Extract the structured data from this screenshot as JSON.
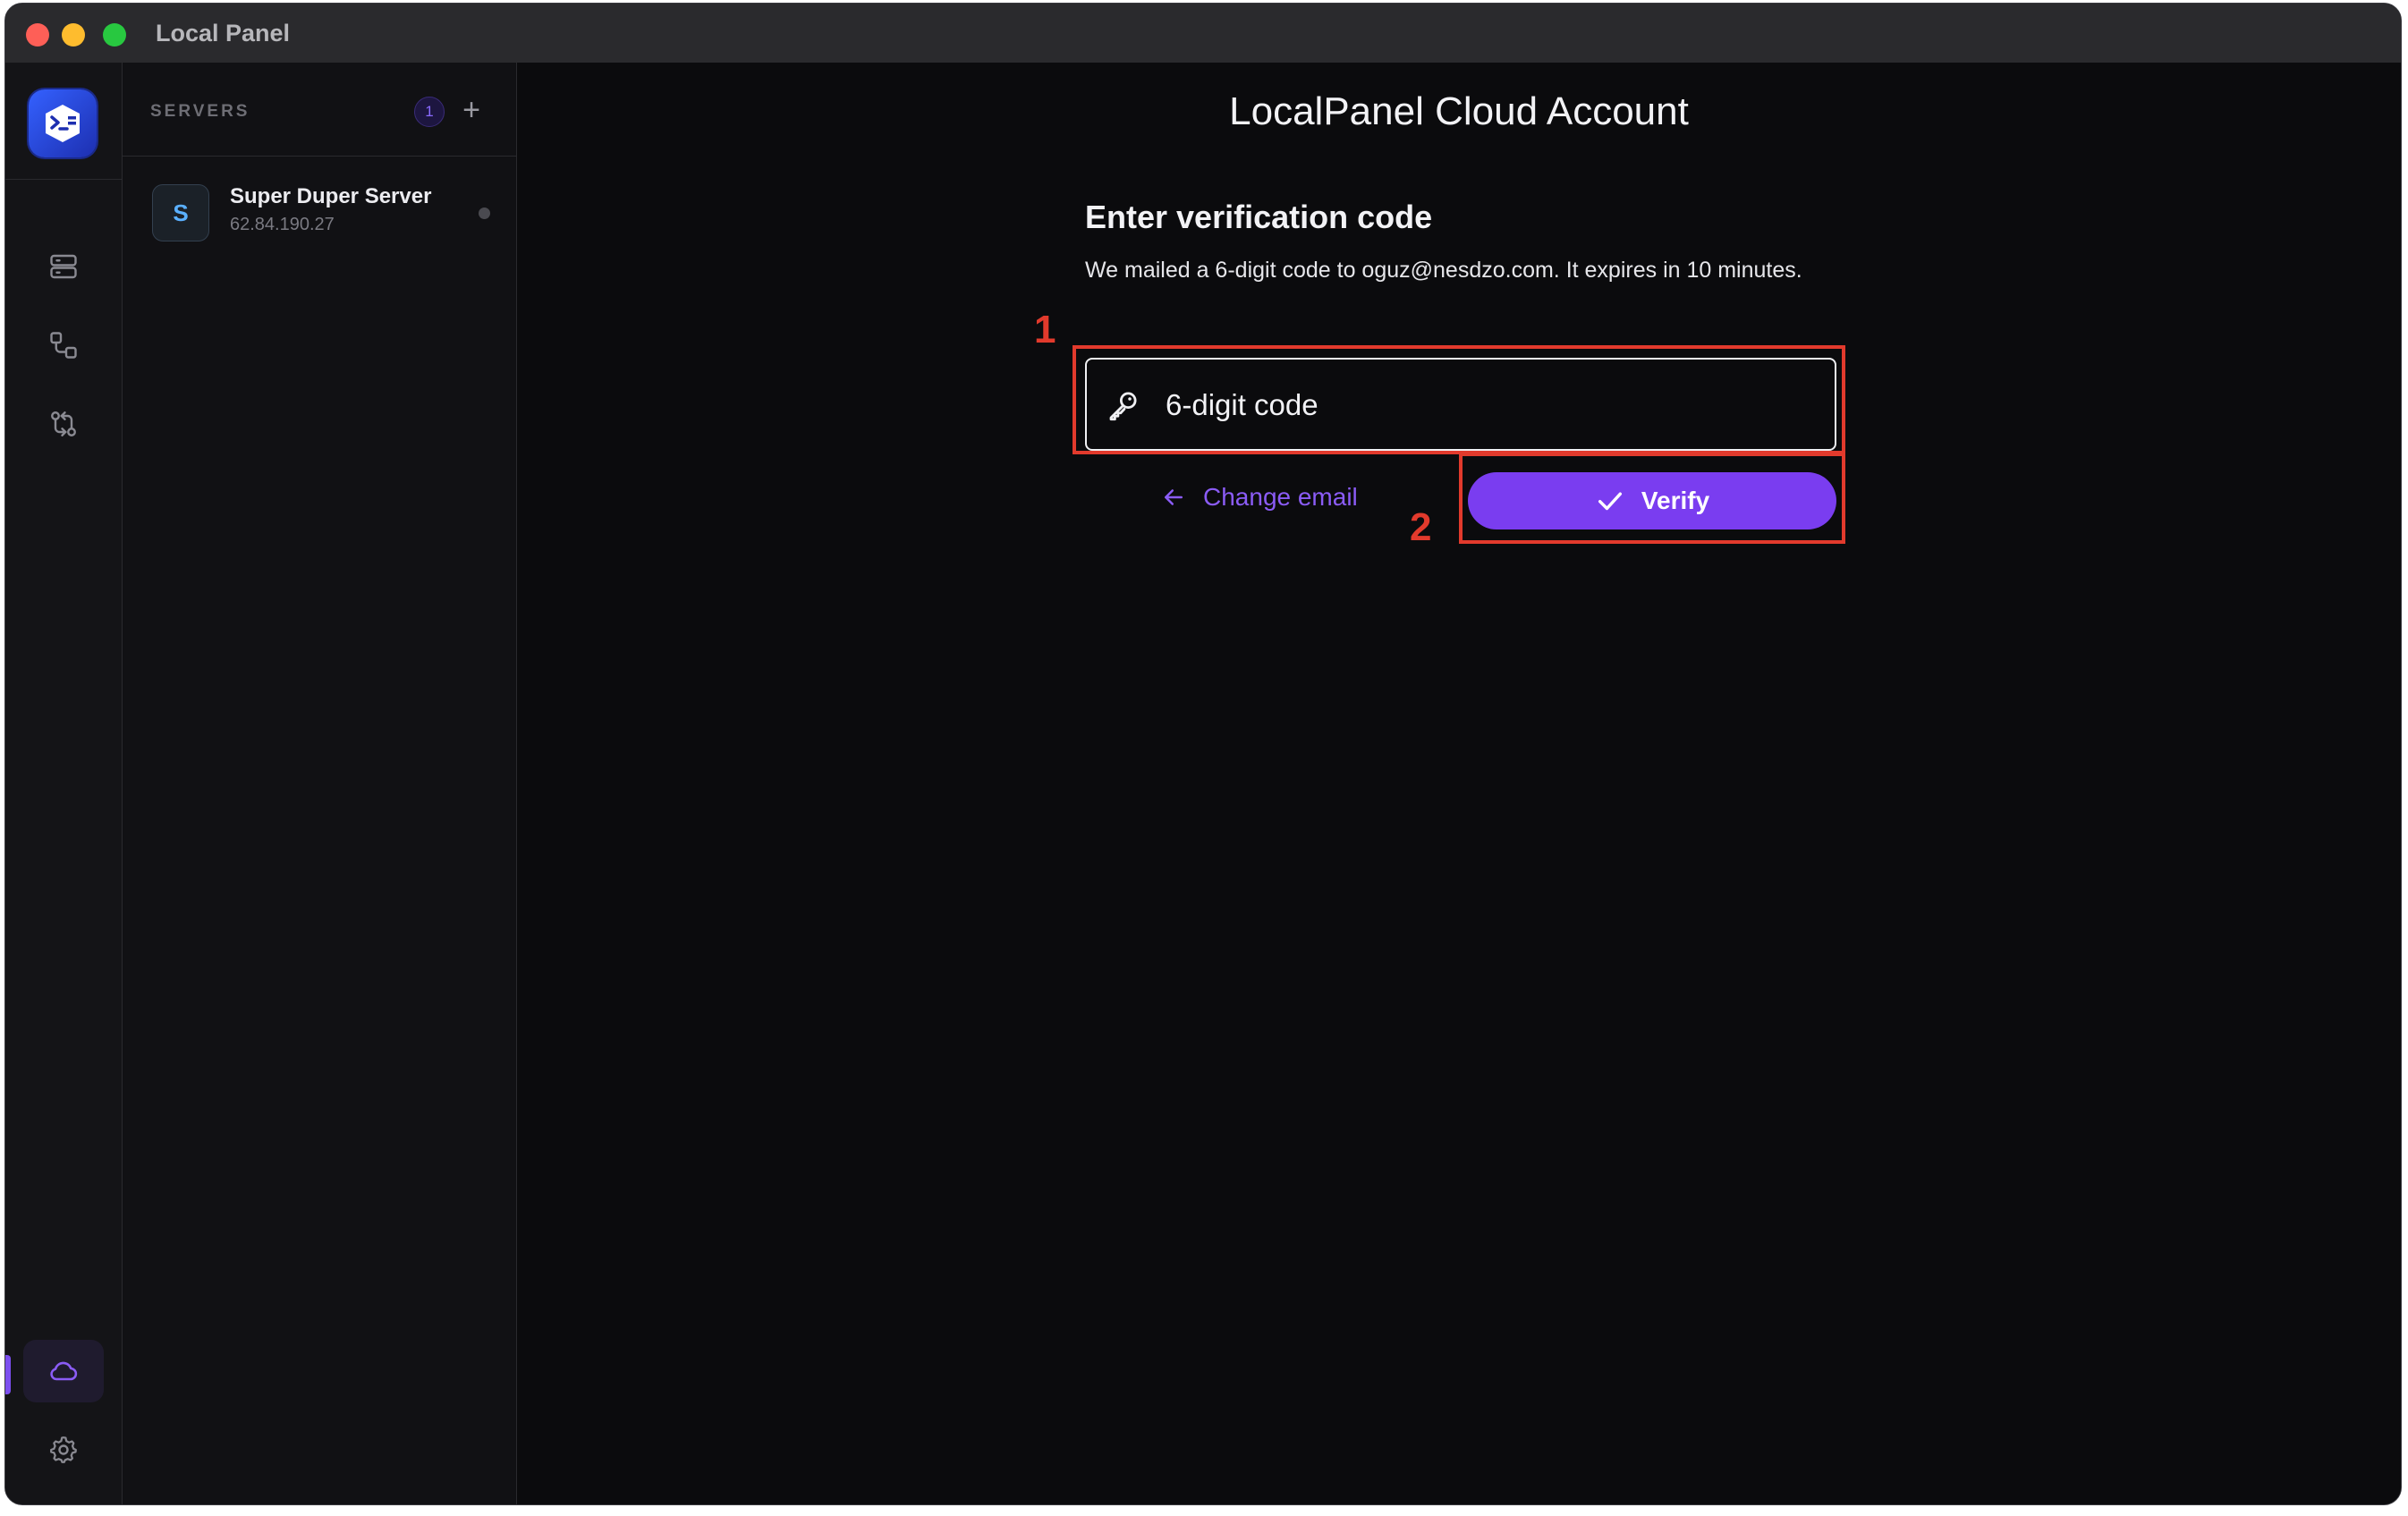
{
  "window": {
    "title": "Local Panel"
  },
  "rail": {
    "logo_icon": "terminal-logo-icon",
    "items": [
      {
        "name": "servers",
        "icon": "server-stack-icon"
      },
      {
        "name": "connections",
        "icon": "nodes-icon"
      },
      {
        "name": "transfers",
        "icon": "git-compare-icon"
      }
    ],
    "bottom_items": [
      {
        "name": "cloud",
        "icon": "cloud-icon",
        "active": true
      },
      {
        "name": "settings",
        "icon": "gear-icon"
      }
    ]
  },
  "servers_panel": {
    "title": "SERVERS",
    "count": "1",
    "add_label": "+",
    "items": [
      {
        "avatar": "S",
        "name": "Super Duper Server",
        "ip": "62.84.190.27",
        "status": "offline"
      }
    ]
  },
  "main": {
    "page_title": "LocalPanel Cloud Account",
    "heading": "Enter verification code",
    "description": "We mailed a 6-digit code to oguz@nesdzo.com. It expires in 10 minutes.",
    "code_input": {
      "placeholder": "6-digit code",
      "value": ""
    },
    "change_email_label": "Change email",
    "verify_label": "Verify"
  },
  "annotations": [
    {
      "label": "1"
    },
    {
      "label": "2"
    }
  ],
  "colors": {
    "accent": "#7a3df0",
    "annotation": "#e23a2c",
    "background": "#0b0b0d"
  }
}
